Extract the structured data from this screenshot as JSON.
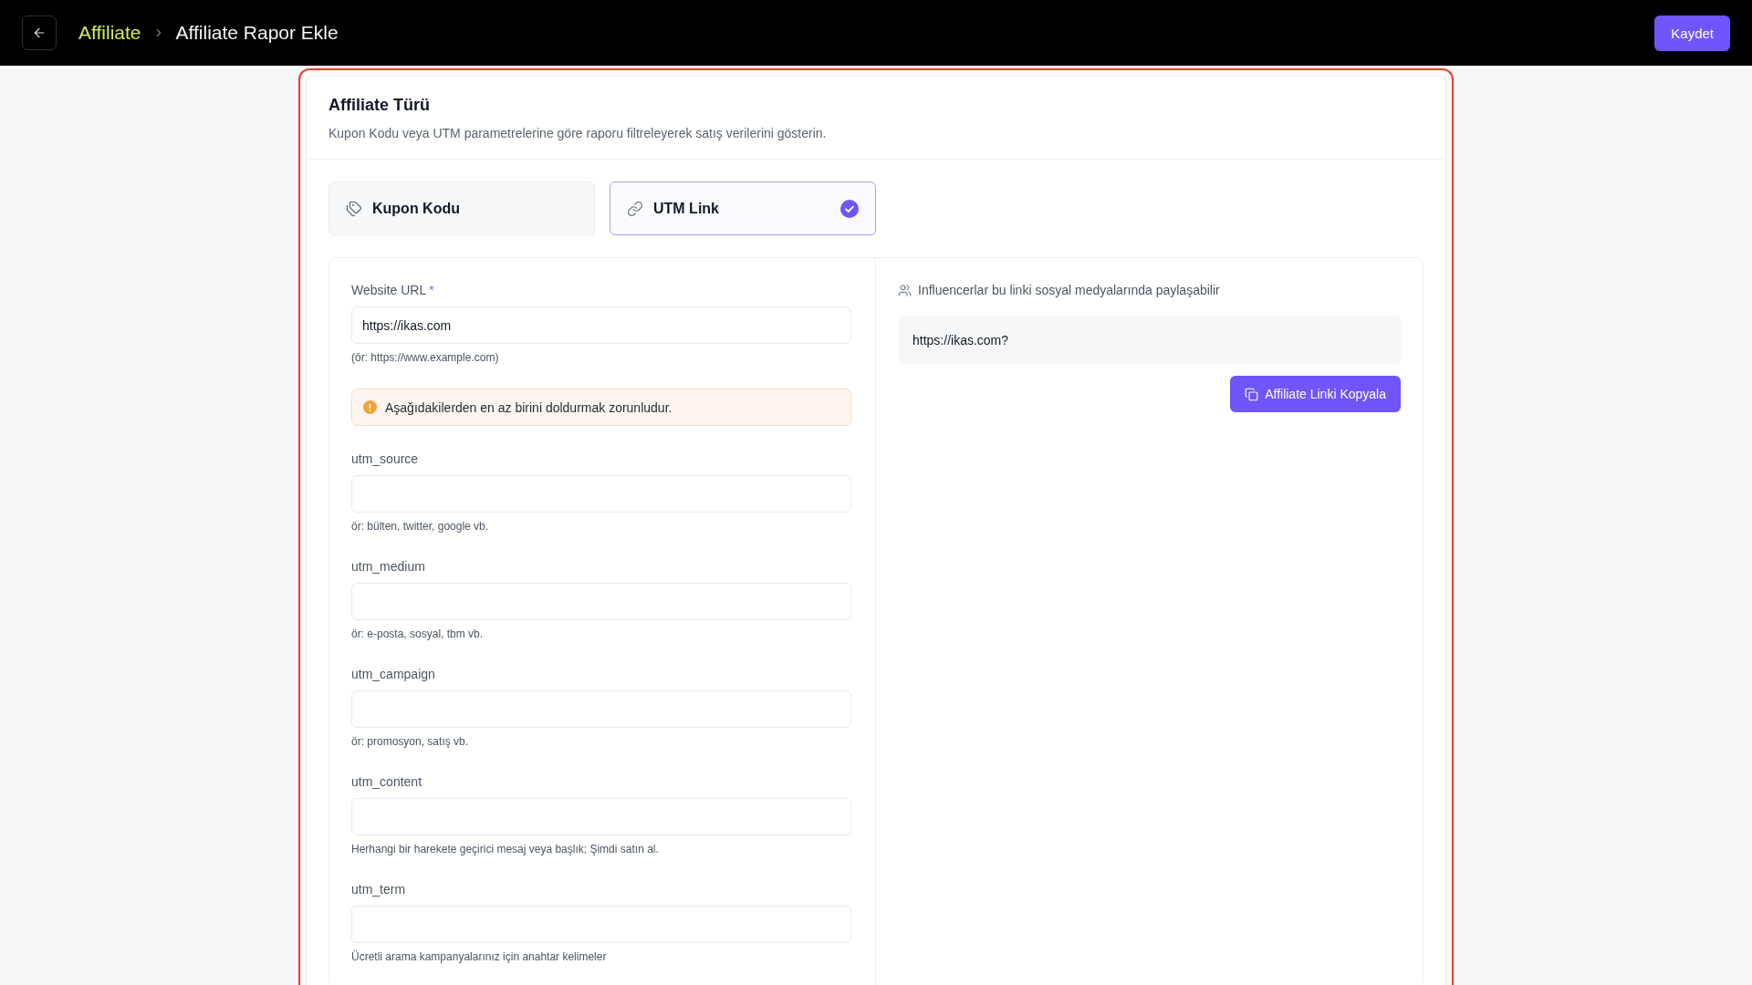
{
  "header": {
    "breadcrumb": [
      {
        "label": "Affiliate"
      },
      {
        "label": "Affiliate Rapor Ekle"
      }
    ],
    "save_button": "Kaydet"
  },
  "section": {
    "title": "Affiliate Türü",
    "description": "Kupon Kodu veya UTM parametrelerine göre raporu filtreleyerek satış verilerini gösterin."
  },
  "type_options": [
    {
      "kind": "coupon",
      "label": "Kupon Kodu",
      "selected": false
    },
    {
      "kind": "link",
      "label": "UTM Link",
      "selected": true
    }
  ],
  "form": {
    "website_url": {
      "label": "Website URL",
      "required_mark": "*",
      "value": "https://ikas.com",
      "hint": "(ör: https://www.example.com)"
    },
    "warning": "Aşağıdakilerden en az birini doldurmak zorunludur.",
    "utm_fields": [
      {
        "label": "utm_source",
        "hint": "ör: bülten, twitter, google vb."
      },
      {
        "label": "utm_medium",
        "hint": "ör: e-posta, sosyal, tbm vb."
      },
      {
        "label": "utm_campaign",
        "hint": "ör: promosyon, satış vb."
      },
      {
        "label": "utm_content",
        "hint": "Herhangi bir harekete geçirici mesaj veya başlık; Şimdi satın al."
      },
      {
        "label": "utm_term",
        "hint": "Ücretli arama kampanyalarınız için anahtar kelimeler"
      }
    ]
  },
  "link_preview": {
    "note": "Influencerlar bu linki sosyal medyalarında paylaşabilir",
    "link": "https://ikas.com?",
    "copy_button": "Affiliate Linki Kopyala"
  }
}
